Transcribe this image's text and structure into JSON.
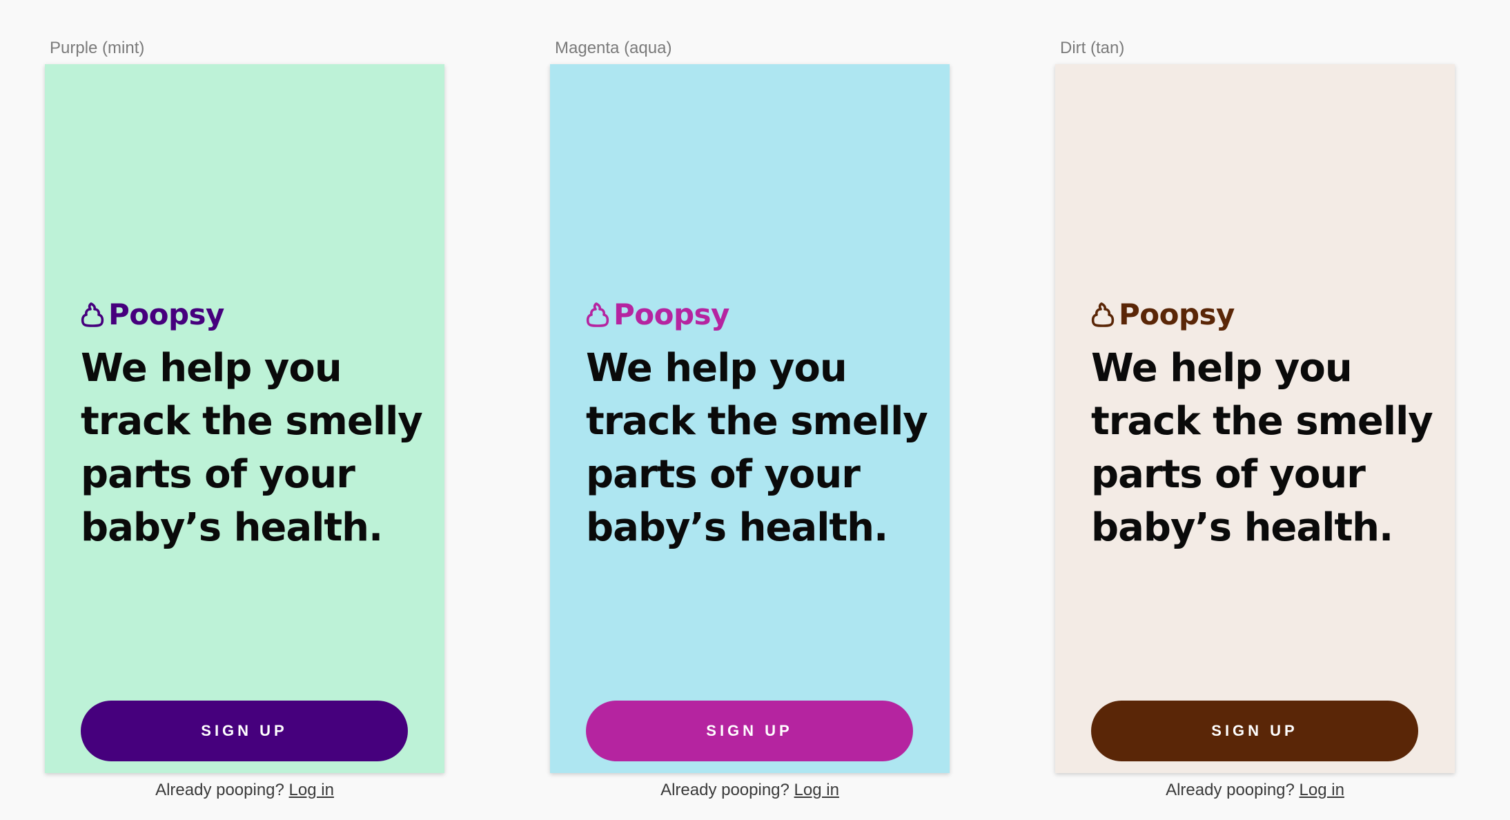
{
  "frames": [
    {
      "label": "Purple (mint)",
      "background": "#bdf2d7",
      "accent": "#46007d",
      "logo_icon": "poop-icon",
      "logo_text": "Poopsy",
      "headline": [
        "We help you",
        "track the smelly",
        "parts of your",
        "baby’s health."
      ],
      "signup_label": "SIGN UP",
      "login_prompt": "Already pooping?",
      "login_link": "Log in"
    },
    {
      "label": "Magenta (aqua)",
      "background": "#aee6f1",
      "accent": "#b524a0",
      "logo_icon": "poop-icon",
      "logo_text": "Poopsy",
      "headline": [
        "We help you",
        "track the smelly",
        "parts of your",
        "baby’s health."
      ],
      "signup_label": "SIGN UP",
      "login_prompt": "Already pooping?",
      "login_link": "Log in"
    },
    {
      "label": "Dirt (tan)",
      "background": "#f3ebe5",
      "accent": "#5a2607",
      "logo_icon": "poop-icon",
      "logo_text": "Poopsy",
      "headline": [
        "We help you",
        "track the smelly",
        "parts of your",
        "baby’s health."
      ],
      "signup_label": "SIGN UP",
      "login_prompt": "Already pooping?",
      "login_link": "Log in"
    }
  ]
}
